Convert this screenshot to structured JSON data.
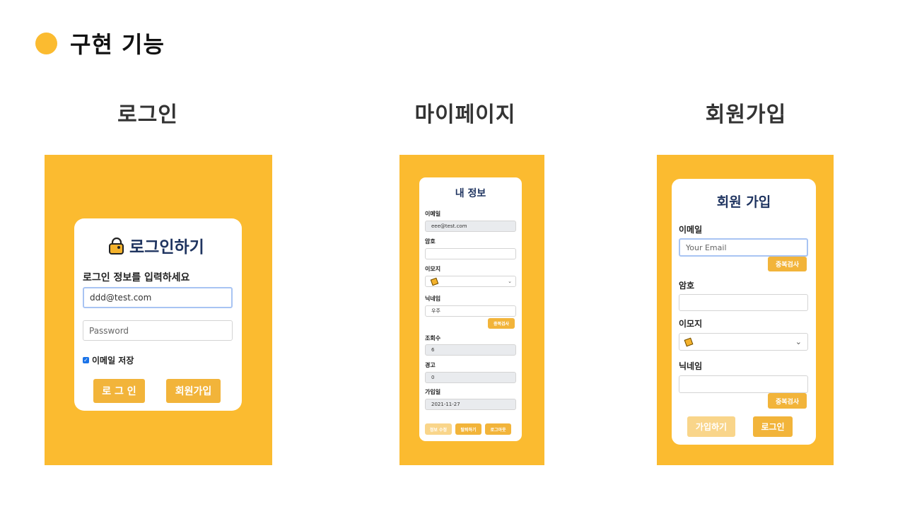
{
  "slide": {
    "title": "구현 기능"
  },
  "columns": [
    {
      "title": "로그인"
    },
    {
      "title": "마이페이지"
    },
    {
      "title": "회원가입"
    }
  ],
  "login": {
    "heading": "로그인하기",
    "subheading": "로그인 정보를 입력하세요",
    "email_value": "ddd@test.com",
    "password_placeholder": "Password",
    "remember_label": "이메일 저장",
    "remember_checked": true,
    "login_button": "로 그 인",
    "signup_button": "회원가입"
  },
  "mypage": {
    "heading": "내 정보",
    "email_label": "이메일",
    "email_value": "eee@test.com",
    "password_label": "암호",
    "emoji_label": "이모지",
    "nickname_label": "닉네임",
    "nickname_value": "우주",
    "dup_check_button": "중복검사",
    "views_label": "조회수",
    "views_value": "6",
    "warning_label": "경고",
    "warning_value": "0",
    "joined_label": "가입일",
    "joined_value": "2021-11-27",
    "edit_button": "정보 수정",
    "withdraw_button": "탈퇴하기",
    "logout_button": "로그아웃"
  },
  "signup": {
    "heading": "회원 가입",
    "email_label": "이메일",
    "email_placeholder": "Your Email",
    "email_dup_button": "중복검사",
    "password_label": "암호",
    "emoji_label": "이모지",
    "nickname_label": "닉네임",
    "nickname_dup_button": "중복검사",
    "join_button": "가입하기",
    "login_button": "로그인"
  },
  "colors": {
    "accent": "#fbbb30",
    "button": "#f2b43a",
    "heading": "#1f3460"
  }
}
